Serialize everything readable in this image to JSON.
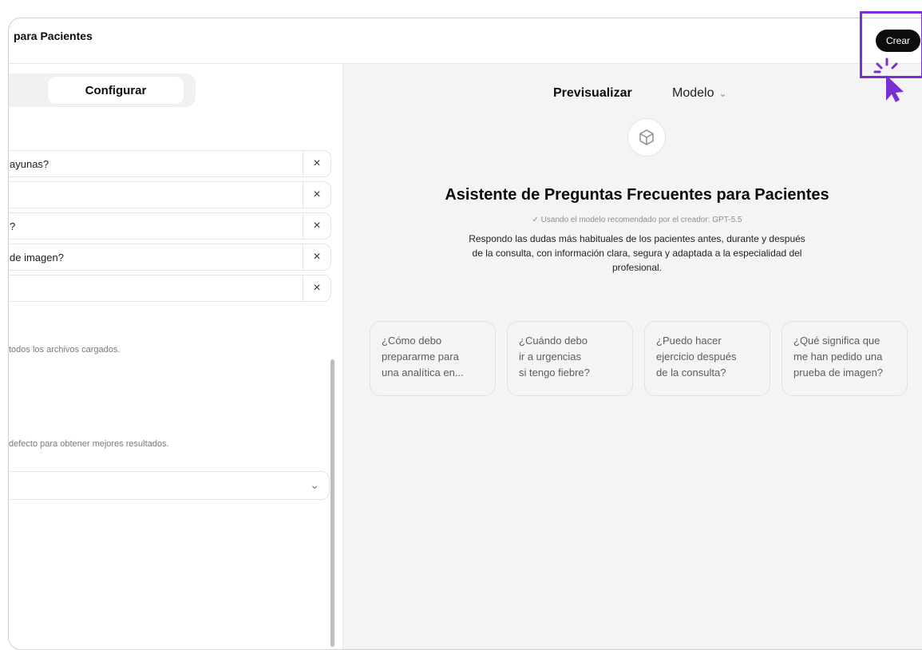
{
  "app": {
    "title": "para Pacientes"
  },
  "toolbar": {
    "create_label": "Crear"
  },
  "left_panel": {
    "configure_tab": "Configurar",
    "starters": [
      {
        "text": "ayunas?",
        "remove": "×"
      },
      {
        "text": "",
        "remove": "×"
      },
      {
        "text": "?",
        "remove": "×"
      },
      {
        "text": "de imagen?",
        "remove": "×"
      },
      {
        "text": "",
        "remove": "×"
      }
    ],
    "files_hint": "todos los archivos cargados.",
    "model_hint": "defecto para obtener mejores resultados.",
    "select_chevron": "⌄"
  },
  "preview": {
    "tab_preview": "Previsualizar",
    "tab_model": "Modelo",
    "tab_model_caret": "⌄",
    "gpt_name": "Asistente de Preguntas Frecuentes para Pacientes",
    "model_note": "✓ Usando el modelo recomendado por el creador: GPT-5.5",
    "description": "Respondo las dudas más habituales de los pacientes antes, durante y después de la consulta, con información clara, segura y adaptada a la especialidad del profesional.",
    "suggestions": [
      {
        "line1": "¿Cómo debo",
        "line2": "prepararme para",
        "line3": "una analítica en..."
      },
      {
        "line1": "¿Cuándo debo",
        "line2": "ir a urgencias",
        "line3": "si tengo fiebre?"
      },
      {
        "line1": "¿Puedo hacer",
        "line2": "ejercicio después",
        "line3": "de la consulta?"
      },
      {
        "line1": "¿Qué significa que",
        "line2": "me han pedido una",
        "line3": "prueba de imagen?"
      }
    ]
  },
  "colors": {
    "highlight": "#7a2ed6",
    "button_bg": "#0d0d0d"
  },
  "icons": {
    "avatar": "cube-icon",
    "cursor": "pointer-cursor-icon"
  }
}
